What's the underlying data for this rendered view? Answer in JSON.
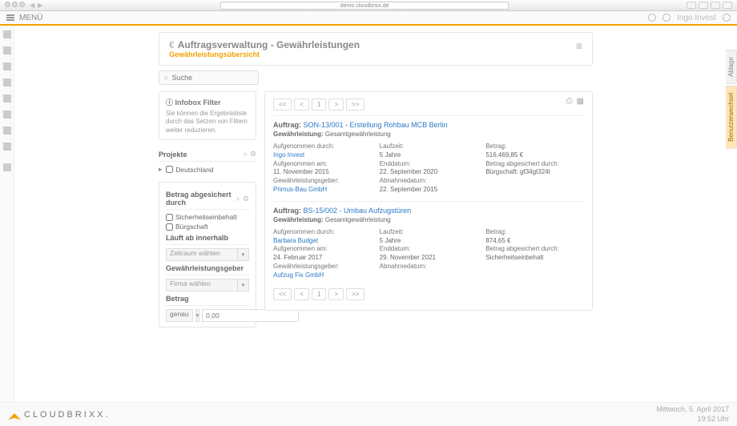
{
  "browser": {
    "url": "demo.cloudbrixx.de"
  },
  "topbar": {
    "menu": "MENÜ",
    "user": "Ingo Invest"
  },
  "header": {
    "title": "Auftragsverwaltung - Gewährleistungen",
    "subtitle": "Gewährleistungsübersicht"
  },
  "search": {
    "placeholder": "Suche"
  },
  "infobox": {
    "title": "Infobox Filter",
    "desc": "Sie können die Ergebnisliste durch das Setzen von Filtern weiter reduzieren."
  },
  "projects": {
    "title": "Projekte",
    "item": "Deutschland"
  },
  "secured": {
    "title": "Betrag abgesichert durch",
    "opt1": "Sicherheitseinbehalt",
    "opt2": "Bürgschaft"
  },
  "expires": {
    "title": "Läuft ab innerhalb",
    "placeholder": "Zeitraum wählen"
  },
  "warrantor": {
    "title": "Gewährleistungsgeber",
    "placeholder": "Firma wählen"
  },
  "amount": {
    "title": "Betrag",
    "mode": "genau",
    "placeholder": "0,00"
  },
  "pager": {
    "first": "<<",
    "prev": "<",
    "page": "1",
    "next": ">",
    "last": ">>"
  },
  "entries": [
    {
      "titlePrefix": "Auftrag:",
      "titleLink": "SON-13/001 - Erstellung Rohbau MCB Berlin",
      "sub": "Gewährleistung: Gesamtgewährleistung",
      "c1": {
        "l1": "Aufgenommen durch:",
        "v1": "Ingo Invest",
        "l2": "Aufgenommen am:",
        "v2": "11. November 2015",
        "l3": "Gewährleistungsgeber:",
        "v3": "Primus-Bau GmbH"
      },
      "c2": {
        "l1": "Laufzeit:",
        "v1": "5 Jahre",
        "l2": "Enddatum:",
        "v2": "22. September 2020",
        "l3": "Abnahmedatum:",
        "v3": "22. September 2015"
      },
      "c3": {
        "l1": "Betrag:",
        "v1": "516.469,85 €",
        "l2": "Betrag abgesichert durch:",
        "v2": "Bürgschaft: gf34gt324t"
      }
    },
    {
      "titlePrefix": "Auftrag:",
      "titleLink": "BS-15/002 - Umbau Aufzugstüren",
      "sub": "Gewährleistung: Gesamtgewährleistung",
      "c1": {
        "l1": "Aufgenommen durch:",
        "v1": "Barbara Budget",
        "l2": "Aufgenommen am:",
        "v2": "24. Februar 2017",
        "l3": "Gewährleistungsgeber:",
        "v3": "Aufzug Fix GmbH"
      },
      "c2": {
        "l1": "Laufzeit:",
        "v1": "5 Jahre",
        "l2": "Enddatum:",
        "v2": "29. November 2021",
        "l3": "Abnahmedatum:",
        "v3": ""
      },
      "c3": {
        "l1": "Betrag:",
        "v1": "874,65 €",
        "l2": "Betrag abgesichert durch:",
        "v2": "Sicherheitseinbehalt"
      }
    }
  ],
  "rtabs": {
    "t1": "Ablage",
    "t2": "Benutzerwechsel"
  },
  "footer": {
    "brand": "CLOUDBRIXX.",
    "date": "Mittwoch, 5. April 2017",
    "time": "19:52 Uhr"
  }
}
